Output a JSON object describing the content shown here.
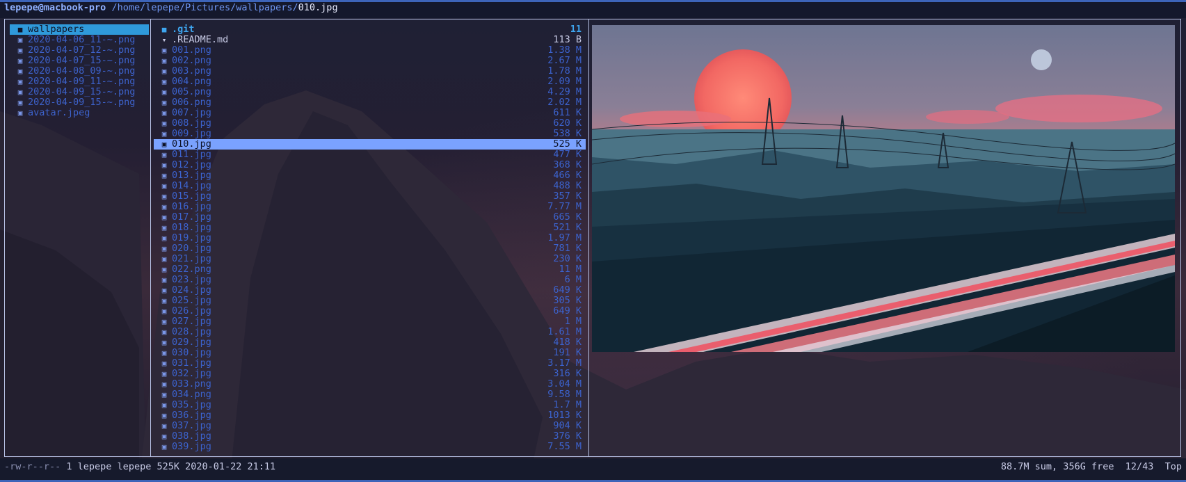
{
  "titlebar": {
    "user_host": "lepepe@macbook-pro",
    "path": "/home/lepepe/Pictures/wallpapers/",
    "filename": "010.jpg"
  },
  "parent_dir": {
    "items": [
      {
        "label": "wallpapers",
        "icon": "folder-icon",
        "selected": true
      },
      {
        "label": "2020-04-06_11-~.png",
        "icon": "image-icon"
      },
      {
        "label": "2020-04-07_12-~.png",
        "icon": "image-icon"
      },
      {
        "label": "2020-04-07_15-~.png",
        "icon": "image-icon"
      },
      {
        "label": "2020-04-08_09-~.png",
        "icon": "image-icon"
      },
      {
        "label": "2020-04-09_11-~.png",
        "icon": "image-icon"
      },
      {
        "label": "2020-04-09_15-~.png",
        "icon": "image-icon"
      },
      {
        "label": "2020-04-09_15-~.png",
        "icon": "image-icon"
      },
      {
        "label": "avatar.jpeg",
        "icon": "image-icon"
      }
    ]
  },
  "current_dir": {
    "items": [
      {
        "name": ".git",
        "size": "11",
        "icon": "folder-icon",
        "kind": "git"
      },
      {
        "name": ".README.md",
        "size": "113 B",
        "icon": "download-icon",
        "kind": "readme"
      },
      {
        "name": "001.png",
        "size": "1.38 M",
        "icon": "image-icon"
      },
      {
        "name": "002.png",
        "size": "2.67 M",
        "icon": "image-icon"
      },
      {
        "name": "003.png",
        "size": "1.78 M",
        "icon": "image-icon"
      },
      {
        "name": "004.png",
        "size": "2.09 M",
        "icon": "image-icon"
      },
      {
        "name": "005.png",
        "size": "4.29 M",
        "icon": "image-icon"
      },
      {
        "name": "006.png",
        "size": "2.02 M",
        "icon": "image-icon"
      },
      {
        "name": "007.jpg",
        "size": "611 K",
        "icon": "image-icon"
      },
      {
        "name": "008.jpg",
        "size": "620 K",
        "icon": "image-icon"
      },
      {
        "name": "009.jpg",
        "size": "538 K",
        "icon": "image-icon"
      },
      {
        "name": "010.jpg",
        "size": "525 K",
        "icon": "image-icon",
        "kind": "sel"
      },
      {
        "name": "011.jpg",
        "size": "477 K",
        "icon": "image-icon"
      },
      {
        "name": "012.jpg",
        "size": "368 K",
        "icon": "image-icon"
      },
      {
        "name": "013.jpg",
        "size": "466 K",
        "icon": "image-icon"
      },
      {
        "name": "014.jpg",
        "size": "488 K",
        "icon": "image-icon"
      },
      {
        "name": "015.jpg",
        "size": "357 K",
        "icon": "image-icon"
      },
      {
        "name": "016.jpg",
        "size": "7.77 M",
        "icon": "image-icon"
      },
      {
        "name": "017.jpg",
        "size": "665 K",
        "icon": "image-icon"
      },
      {
        "name": "018.jpg",
        "size": "521 K",
        "icon": "image-icon"
      },
      {
        "name": "019.jpg",
        "size": "1.97 M",
        "icon": "image-icon"
      },
      {
        "name": "020.jpg",
        "size": "781 K",
        "icon": "image-icon"
      },
      {
        "name": "021.jpg",
        "size": "230 K",
        "icon": "image-icon"
      },
      {
        "name": "022.png",
        "size": "11 M",
        "icon": "image-icon"
      },
      {
        "name": "023.jpg",
        "size": "6 M",
        "icon": "image-icon"
      },
      {
        "name": "024.jpg",
        "size": "649 K",
        "icon": "image-icon"
      },
      {
        "name": "025.jpg",
        "size": "305 K",
        "icon": "image-icon"
      },
      {
        "name": "026.jpg",
        "size": "649 K",
        "icon": "image-icon"
      },
      {
        "name": "027.jpg",
        "size": "1 M",
        "icon": "image-icon"
      },
      {
        "name": "028.jpg",
        "size": "1.61 M",
        "icon": "image-icon"
      },
      {
        "name": "029.jpg",
        "size": "418 K",
        "icon": "image-icon"
      },
      {
        "name": "030.jpg",
        "size": "191 K",
        "icon": "image-icon"
      },
      {
        "name": "031.jpg",
        "size": "3.17 M",
        "icon": "image-icon"
      },
      {
        "name": "032.jpg",
        "size": "316 K",
        "icon": "image-icon"
      },
      {
        "name": "033.png",
        "size": "3.04 M",
        "icon": "image-icon"
      },
      {
        "name": "034.png",
        "size": "9.58 M",
        "icon": "image-icon"
      },
      {
        "name": "035.jpg",
        "size": "1.7 M",
        "icon": "image-icon"
      },
      {
        "name": "036.jpg",
        "size": "1013 K",
        "icon": "image-icon"
      },
      {
        "name": "037.jpg",
        "size": "904 K",
        "icon": "image-icon"
      },
      {
        "name": "038.jpg",
        "size": "376 K",
        "icon": "image-icon"
      },
      {
        "name": "039.jpg",
        "size": "7.55 M",
        "icon": "image-icon"
      }
    ]
  },
  "statusbar": {
    "permissions": "-rw-r--r--",
    "info": " 1 lepepe lepepe 525K 2020-01-22 21:11",
    "summary": "88.7M sum, 356G free  12/43  Top"
  },
  "preview": {
    "description_icon": "image-preview"
  },
  "colors": {
    "accent": "#3d64b9",
    "selection": "#7aa2ff",
    "dir_highlight": "#2f9adb",
    "file_text": "#3c63cf"
  }
}
